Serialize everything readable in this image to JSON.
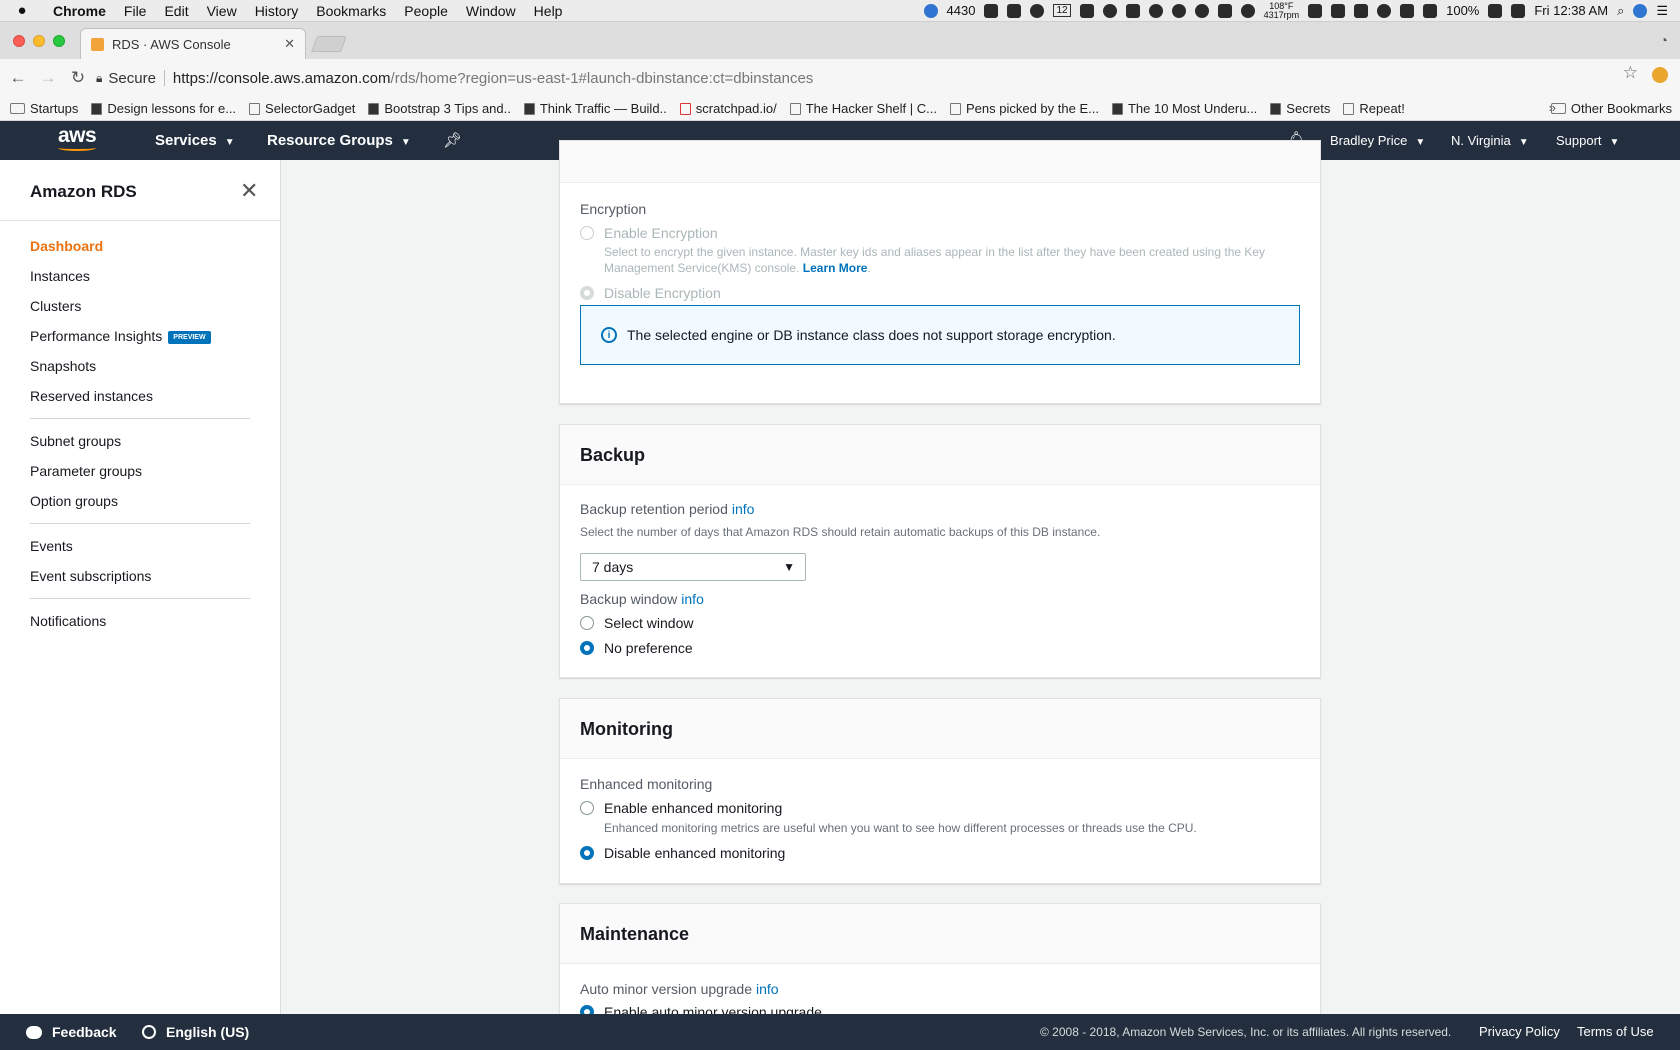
{
  "mac_menubar": {
    "app": "Chrome",
    "items": [
      "File",
      "Edit",
      "View",
      "History",
      "Bookmarks",
      "People",
      "Window",
      "Help"
    ],
    "status": {
      "counter": "4430",
      "calendar_day": "12",
      "temperature": "108°F",
      "rpm": "4317rpm",
      "battery": "100%",
      "clock": "Fri 12:38 AM"
    }
  },
  "chrome": {
    "tab_title": "RDS · AWS Console",
    "secure_label": "Secure",
    "url_host": "https://console.aws.amazon.com",
    "url_rest": "/rds/home?region=us-east-1#launch-dbinstance:ct=dbinstances",
    "bookmarks": [
      "Startups",
      "Design lessons for e...",
      "SelectorGadget",
      "Bootstrap 3 Tips and..",
      "Think Traffic — Build..",
      "scratchpad.io/",
      "The Hacker Shelf | C...",
      "Pens picked by the E...",
      "The 10 Most Underu...",
      "Secrets",
      "Repeat!"
    ],
    "bookmarks_more": "»",
    "other_bookmarks": "Other Bookmarks"
  },
  "aws_nav": {
    "logo": "aws",
    "services": "Services",
    "resource_groups": "Resource Groups",
    "user": "Bradley Price",
    "region": "N. Virginia",
    "support": "Support"
  },
  "sidebar": {
    "title": "Amazon RDS",
    "items": [
      {
        "label": "Dashboard"
      },
      {
        "label": "Instances"
      },
      {
        "label": "Clusters"
      },
      {
        "label": "Performance Insights",
        "badge": "PREVIEW"
      },
      {
        "label": "Snapshots"
      },
      {
        "label": "Reserved instances"
      },
      {
        "label": "Subnet groups"
      },
      {
        "label": "Parameter groups"
      },
      {
        "label": "Option groups"
      },
      {
        "label": "Events"
      },
      {
        "label": "Event subscriptions"
      },
      {
        "label": "Notifications"
      }
    ]
  },
  "encryption": {
    "label": "Encryption",
    "enable_label": "Enable Encryption",
    "enable_desc_1": "Select to encrypt the given instance. Master key ids and aliases appear in the list after they have been created using the Key",
    "enable_desc_2": "Management Service(KMS) console.",
    "learn_more": "Learn More",
    "disable_label": "Disable Encryption",
    "alert_text": "The selected engine or DB instance class does not support storage encryption."
  },
  "backup": {
    "title": "Backup",
    "retention_label": "Backup retention period",
    "info": "info",
    "retention_desc": "Select the number of days that Amazon RDS should retain automatic backups of this DB instance.",
    "retention_value": "7 days",
    "window_label": "Backup window",
    "select_window": "Select window",
    "no_preference": "No preference"
  },
  "monitoring": {
    "title": "Monitoring",
    "enhanced_label": "Enhanced monitoring",
    "enable_label": "Enable enhanced monitoring",
    "enable_desc": "Enhanced monitoring metrics are useful when you want to see how different processes or threads use the CPU.",
    "disable_label": "Disable enhanced monitoring"
  },
  "maintenance": {
    "title": "Maintenance",
    "auto_minor_label": "Auto minor version upgrade",
    "enable_auto_minor": "Enable auto minor version upgrade"
  },
  "footer": {
    "feedback": "Feedback",
    "language": "English (US)",
    "copyright": "© 2008 - 2018, Amazon Web Services, Inc. or its affiliates. All rights reserved.",
    "privacy": "Privacy Policy",
    "terms": "Terms of Use"
  },
  "colors": {
    "aws_nav_bg": "#232f3e",
    "aws_orange": "#ec7211",
    "link_blue": "#0073bb",
    "page_bg": "#f2f3f3"
  }
}
